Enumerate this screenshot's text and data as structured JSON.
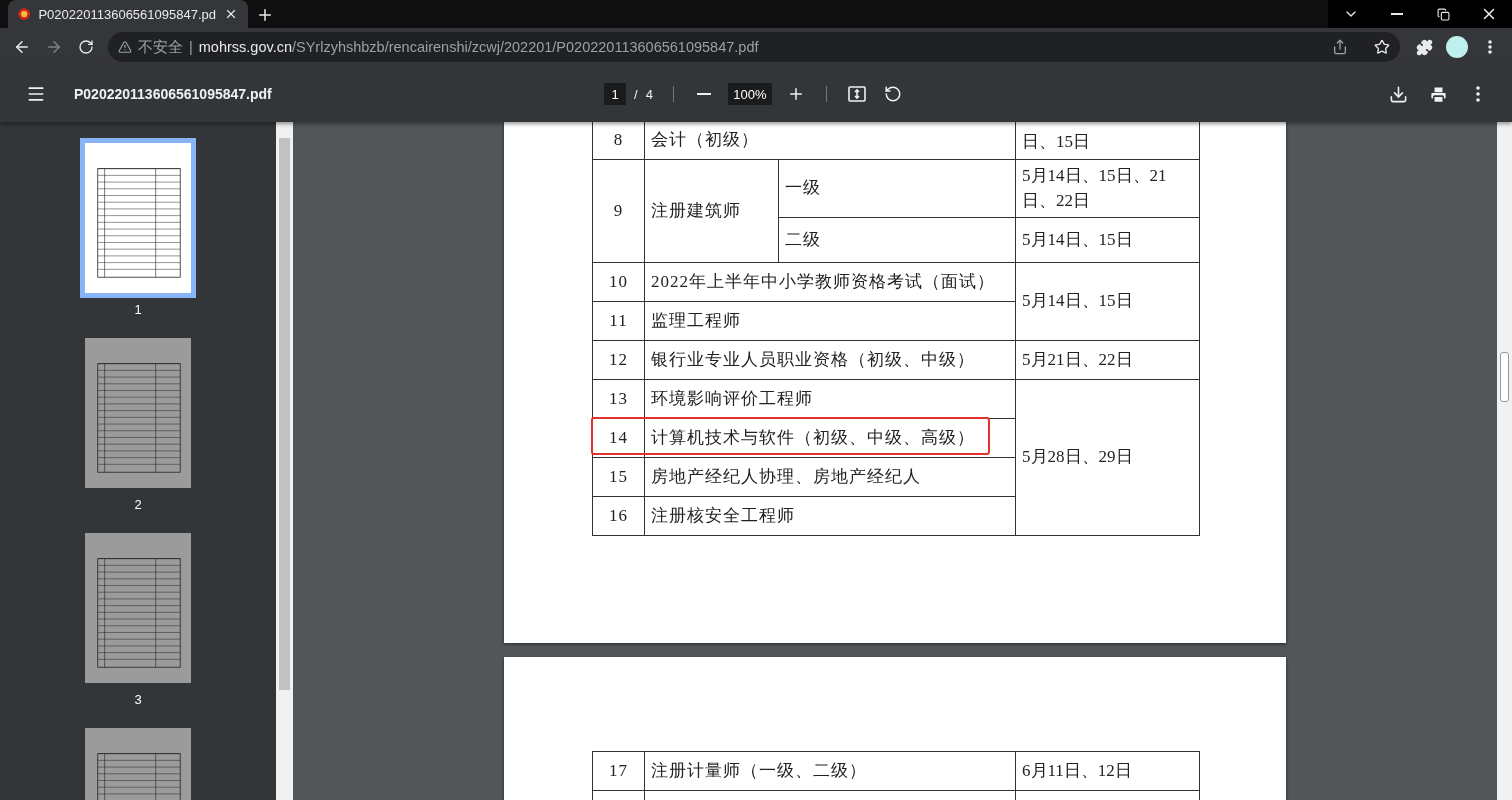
{
  "browser": {
    "tab": {
      "title": "P020220113606561095847.pd"
    },
    "security": "不安全",
    "security_separator": "|",
    "url_host": "mohrss.gov.cn",
    "url_path": "/SYrlzyhshbzb/rencairenshi/zcwj/202201/P020220113606561095847.pdf"
  },
  "pdf_toolbar": {
    "filename": "P020220113606561095847.pdf",
    "page_current": "1",
    "page_separator": "/",
    "page_total": "4",
    "zoom": "100%"
  },
  "sidebar": {
    "thumbnails": [
      {
        "label": "1",
        "selected": true
      },
      {
        "label": "2",
        "selected": false
      },
      {
        "label": "3",
        "selected": false
      },
      {
        "selected": false
      }
    ]
  },
  "pages": [
    {
      "groups": [
        {
          "date": "日、15日",
          "items": [
            {
              "num": "8",
              "name": "会计（初级）",
              "highlighted": false
            }
          ]
        },
        {
          "items": [
            {
              "num": "9",
              "name": "注册建筑师",
              "highlighted": false,
              "levels": [
                {
                  "label": "一级",
                  "date": "5月14日、15日、21日、22日"
                },
                {
                  "label": "二级",
                  "date": "5月14日、15日"
                }
              ]
            }
          ]
        },
        {
          "date": "5月14日、15日",
          "items": [
            {
              "num": "10",
              "name": "2022年上半年中小学教师资格考试（面试）",
              "highlighted": false
            },
            {
              "num": "11",
              "name": "监理工程师",
              "highlighted": false
            }
          ]
        },
        {
          "date": "5月21日、22日",
          "items": [
            {
              "num": "12",
              "name": "银行业专业人员职业资格（初级、中级）",
              "highlighted": false
            }
          ]
        },
        {
          "date": "5月28日、29日",
          "items": [
            {
              "num": "13",
              "name": "环境影响评价工程师",
              "highlighted": false
            },
            {
              "num": "14",
              "name": "计算机技术与软件（初级、中级、高级）",
              "highlighted": true
            },
            {
              "num": "15",
              "name": "房地产经纪人协理、房地产经纪人",
              "highlighted": false
            },
            {
              "num": "16",
              "name": "注册核安全工程师",
              "highlighted": false
            }
          ]
        }
      ]
    },
    {
      "groups": [
        {
          "date": "6月11日、12日",
          "items": [
            {
              "num": "17",
              "name": "注册计量师（一级、二级）",
              "highlighted": false
            }
          ]
        }
      ]
    }
  ]
}
